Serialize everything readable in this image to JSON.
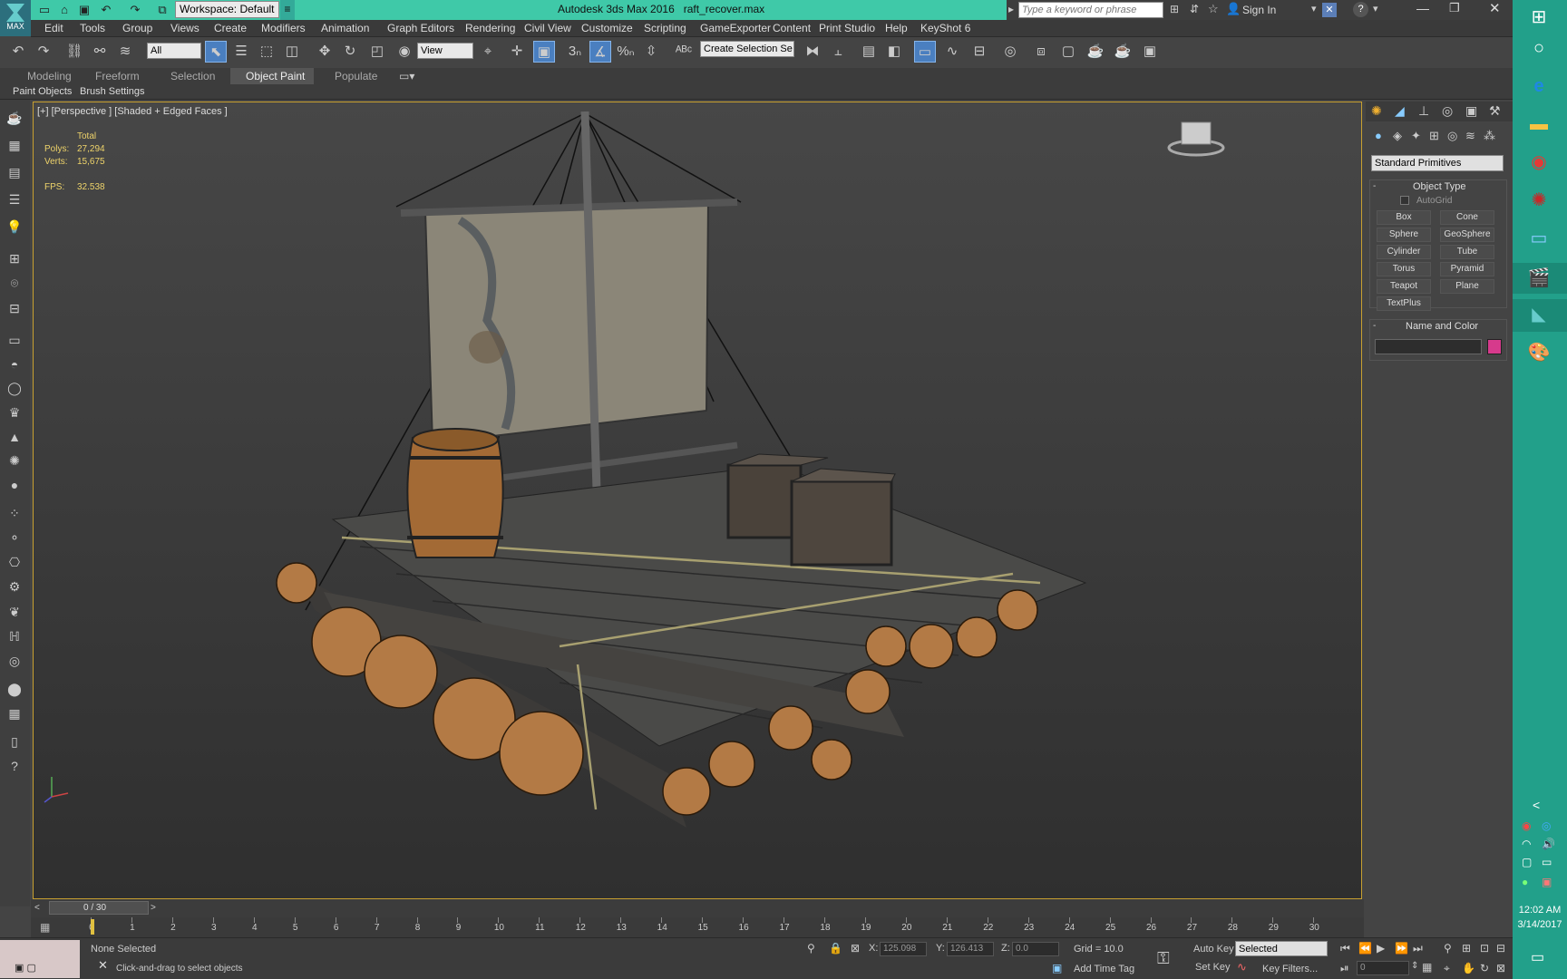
{
  "title": {
    "workspace": "Workspace: Default",
    "app": "Autodesk 3ds Max 2016",
    "file": "raft_recover.max",
    "search_placeholder": "Type a keyword or phrase",
    "signin": "Sign In",
    "logo": "MAX"
  },
  "menu": [
    "Edit",
    "Tools",
    "Group",
    "Views",
    "Create",
    "Modifiers",
    "Animation",
    "Graph Editors",
    "Rendering",
    "Civil View",
    "Customize",
    "Scripting",
    "GameExporter",
    "Content",
    "Print Studio",
    "Help",
    "KeyShot 6"
  ],
  "toolbar": {
    "filter": "All",
    "view": "View",
    "selection_set": "Create Selection Se"
  },
  "ribbon": {
    "tabs": [
      "Modeling",
      "Freeform",
      "Selection",
      "Object Paint",
      "Populate"
    ],
    "active": "Object Paint",
    "sub": [
      "Paint Objects",
      "Brush Settings"
    ]
  },
  "viewport": {
    "label": "[+] [Perspective ] [Shaded + Edged Faces ]",
    "stats": {
      "header": "Total",
      "polys_label": "Polys:",
      "polys": "27,294",
      "verts_label": "Verts:",
      "verts": "15,675",
      "fps_label": "FPS:",
      "fps": "32.538"
    }
  },
  "command_panel": {
    "dropdown": "Standard Primitives",
    "object_type": "Object Type",
    "autogrid": "AutoGrid",
    "buttons": [
      "Box",
      "Cone",
      "Sphere",
      "GeoSphere",
      "Cylinder",
      "Tube",
      "Torus",
      "Pyramid",
      "Teapot",
      "Plane",
      "TextPlus"
    ],
    "name_color": "Name and Color",
    "color": "#d63a8c"
  },
  "timeline": {
    "frame": "0 / 30",
    "ticks": [
      "0",
      "1",
      "2",
      "3",
      "4",
      "5",
      "6",
      "7",
      "8",
      "9",
      "10",
      "11",
      "12",
      "13",
      "14",
      "15",
      "16",
      "17",
      "18",
      "19",
      "20",
      "21",
      "22",
      "23",
      "24",
      "25",
      "26",
      "27",
      "28",
      "29",
      "30"
    ]
  },
  "status": {
    "selection": "None Selected",
    "prompt": "Click-and-drag to select objects",
    "x_label": "X:",
    "x": "125.098",
    "y_label": "Y:",
    "y": "126.413",
    "z_label": "Z:",
    "z": "0.0",
    "grid": "Grid = 10.0",
    "add_time_tag": "Add Time Tag",
    "auto_key": "Auto Key",
    "set_key": "Set Key",
    "key_mode": "Selected",
    "key_filters": "Key Filters...",
    "frame_field": "0"
  },
  "taskbar": {
    "time": "12:02 AM",
    "date": "3/14/2017"
  }
}
